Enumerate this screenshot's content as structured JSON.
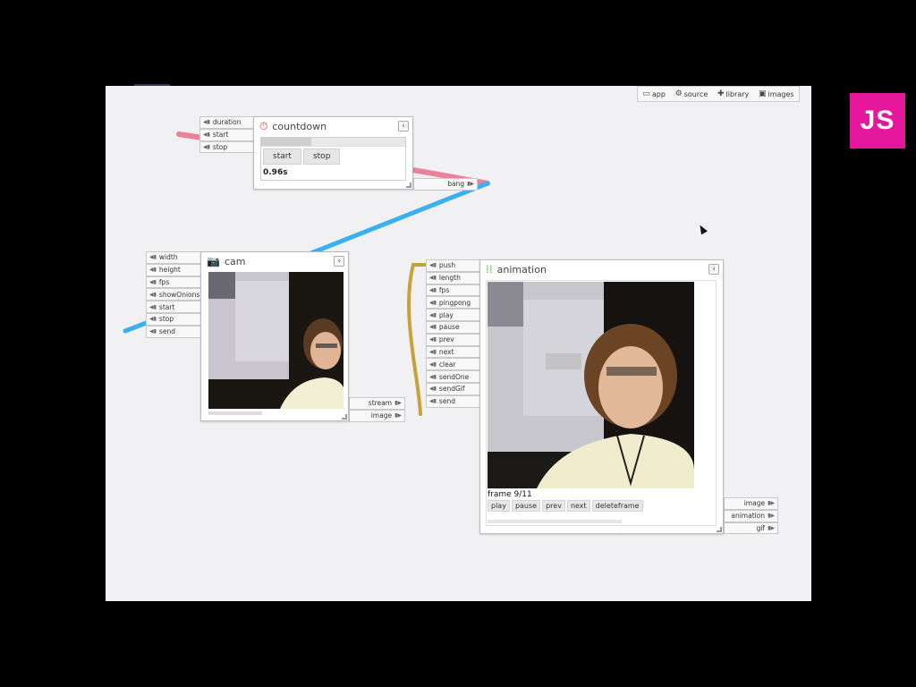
{
  "toolbar": {
    "items": [
      {
        "label": "app",
        "icon": "folder-icon"
      },
      {
        "label": "source",
        "icon": "gear-icon"
      },
      {
        "label": "library",
        "icon": "plus-icon"
      },
      {
        "label": "images",
        "icon": "images-icon"
      }
    ]
  },
  "badge": {
    "label": "JS"
  },
  "countdown": {
    "title": "countdown",
    "inputs": [
      "duration",
      "start",
      "stop"
    ],
    "outputs": [
      "bang"
    ],
    "buttons": {
      "start": "start",
      "stop": "stop"
    },
    "time": "0.96s",
    "progress": 0.35
  },
  "cam": {
    "title": "cam",
    "inputs": [
      "width",
      "height",
      "fps",
      "showOnions",
      "start",
      "stop",
      "send"
    ],
    "outputs": [
      "stream",
      "image"
    ]
  },
  "animation": {
    "title": "animation",
    "inputs": [
      "push",
      "length",
      "fps",
      "pingpong",
      "play",
      "pause",
      "prev",
      "next",
      "clear",
      "sendOne",
      "sendGif",
      "send"
    ],
    "outputs": [
      "image",
      "animation",
      "gif"
    ],
    "frame_label": "frame 9/11",
    "controls": [
      "play",
      "pause",
      "prev",
      "next",
      "deleteframe"
    ]
  },
  "colors": {
    "wire_blue": "#3ab0ef",
    "wire_pink": "#e9738f",
    "wire_gold": "#c7a23a",
    "badge": "#e5179b"
  }
}
